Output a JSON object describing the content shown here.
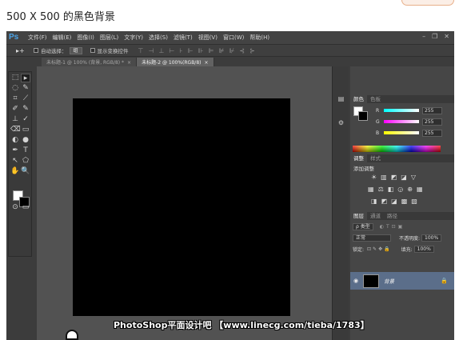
{
  "caption": "500 X 500 的黑色背景",
  "app": {
    "logo": "Ps",
    "menu": [
      "文件(F)",
      "编辑(E)",
      "图像(I)",
      "图层(L)",
      "文字(Y)",
      "选择(S)",
      "滤镜(T)",
      "视图(V)",
      "窗口(W)",
      "帮助(H)"
    ],
    "window_controls": [
      "–",
      "❐",
      "✕"
    ]
  },
  "options": {
    "tool_icon": "▸+",
    "auto_select_label": "自动选择：",
    "auto_select_value": "组",
    "show_transform_label": "显示变换控件",
    "align_icons": [
      "⊤",
      "⊣",
      "⊥",
      "⊢",
      "⊦",
      "⊩",
      "⊪",
      "⊫",
      "⊯",
      "⊮",
      "⊰",
      "⊱"
    ]
  },
  "tabs": [
    {
      "label": "未标题-1 @ 100% (背景, RGB/8) *",
      "close": "×",
      "active": false
    },
    {
      "label": "未标题-2 @ 100%(RGB/8)",
      "close": "×",
      "active": true
    }
  ],
  "tools": [
    "⬚",
    "▸",
    "◌",
    "✎",
    "⌗",
    "⟋",
    "✐",
    "✎",
    "⊥",
    "✓",
    "⌫",
    "▭",
    "◐",
    "●",
    "✒",
    "T",
    "↖",
    "⬠",
    "✋",
    "🔍",
    "⊙",
    "▭"
  ],
  "colors": {
    "foreground": "#ffffff",
    "background": "#000000"
  },
  "color_panel": {
    "tabs": [
      "颜色",
      "色板"
    ],
    "rows": [
      {
        "label": "R",
        "value": "255",
        "gradient": "linear-gradient(to right, #00ffff, #ffffff)"
      },
      {
        "label": "G",
        "value": "255",
        "gradient": "linear-gradient(to right, #ff00ff, #ffffff)"
      },
      {
        "label": "B",
        "value": "255",
        "gradient": "linear-gradient(to right, #ffff00, #ffffff)"
      }
    ]
  },
  "adjustments_panel": {
    "tabs": [
      "调整",
      "样式"
    ],
    "title": "添加调整",
    "row1": [
      "☀",
      "▥",
      "◩",
      "◪",
      "▽"
    ],
    "row2": [
      "▦",
      "⚖",
      "◧",
      "◶",
      "⊕",
      "▦"
    ],
    "row3": [
      "◨",
      "◩",
      "◪",
      "▩",
      "▧"
    ]
  },
  "layers_panel": {
    "tabs": [
      "图层",
      "通道",
      "路径"
    ],
    "kind_label": "ρ 类型",
    "blend_mode": "正常",
    "opacity_label": "不透明度:",
    "opacity_value": "100%",
    "lock_label": "锁定:",
    "fill_label": "填充:",
    "fill_value": "100%",
    "layers": [
      {
        "name": "背景",
        "visible_icon": "◉",
        "lock_icon": "🔒"
      }
    ]
  },
  "watermark": "PhotoShop平面设计吧 【www.linecg.com/tieba/1783】"
}
